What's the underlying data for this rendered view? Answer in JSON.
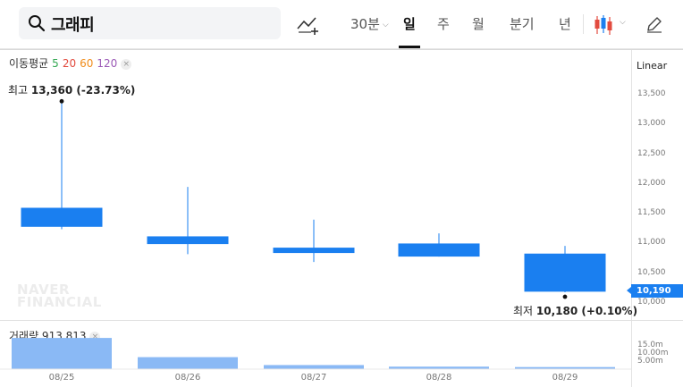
{
  "search": {
    "value": "그래피"
  },
  "toolbar": {
    "periods": [
      {
        "label": "30분",
        "active": false
      },
      {
        "label": "일",
        "active": true
      },
      {
        "label": "주",
        "active": false
      },
      {
        "label": "월",
        "active": false
      },
      {
        "label": "분기",
        "active": false
      },
      {
        "label": "년",
        "active": false
      }
    ]
  },
  "indicators": {
    "ma_label": "이동평균",
    "ma_periods": [
      {
        "value": "5",
        "color": "#33a852"
      },
      {
        "value": "20",
        "color": "#e24b3f"
      },
      {
        "value": "60",
        "color": "#f08c1a"
      },
      {
        "value": "120",
        "color": "#9b59b6"
      }
    ],
    "volume_label": "거래량 913,813",
    "close_glyph": "×"
  },
  "scale_mode": "Linear",
  "annotations": {
    "high_prefix": "최고",
    "high_value": "13,360 (-23.73%)",
    "low_prefix": "최저",
    "low_value": "10,180 (+0.10%)"
  },
  "current_price": "10,190",
  "watermark": [
    "NAVER",
    "FINANCIAL"
  ],
  "volume_axis": [
    "15.0m",
    "10.00m",
    "5.00m"
  ],
  "colors": {
    "down": "#1a7ff0",
    "volume": "#8ab9f5",
    "accent": "#111111"
  },
  "chart_data": [
    {
      "type": "candlestick",
      "categories": [
        "08/25",
        "08/26",
        "08/27",
        "08/28",
        "08/29"
      ],
      "series": [
        {
          "open": 11600,
          "high": 13360,
          "low": 11240,
          "close": 11280
        },
        {
          "open": 11120,
          "high": 11950,
          "low": 10820,
          "close": 10990
        },
        {
          "open": 10930,
          "high": 11400,
          "low": 10690,
          "close": 10840
        },
        {
          "open": 11000,
          "high": 11170,
          "low": 10780,
          "close": 10780
        },
        {
          "open": 10830,
          "high": 10960,
          "low": 10180,
          "close": 10190
        }
      ],
      "ylim": [
        10000,
        13500
      ],
      "yticks": [
        13500,
        13000,
        12500,
        12000,
        11500,
        11000,
        10500,
        10000
      ],
      "ytick_labels": [
        "13,500",
        "13,000",
        "12,500",
        "12,000",
        "11,500",
        "11,000",
        "10,500",
        "10,000"
      ],
      "ylabel": ""
    },
    {
      "type": "bar",
      "categories": [
        "08/25",
        "08/26",
        "08/27",
        "08/28",
        "08/29"
      ],
      "values": [
        13800000,
        5300000,
        1800000,
        1100000,
        913813
      ],
      "ylim": [
        0,
        17000000
      ],
      "ytick_values": [
        15000000,
        10000000,
        5000000
      ]
    }
  ]
}
